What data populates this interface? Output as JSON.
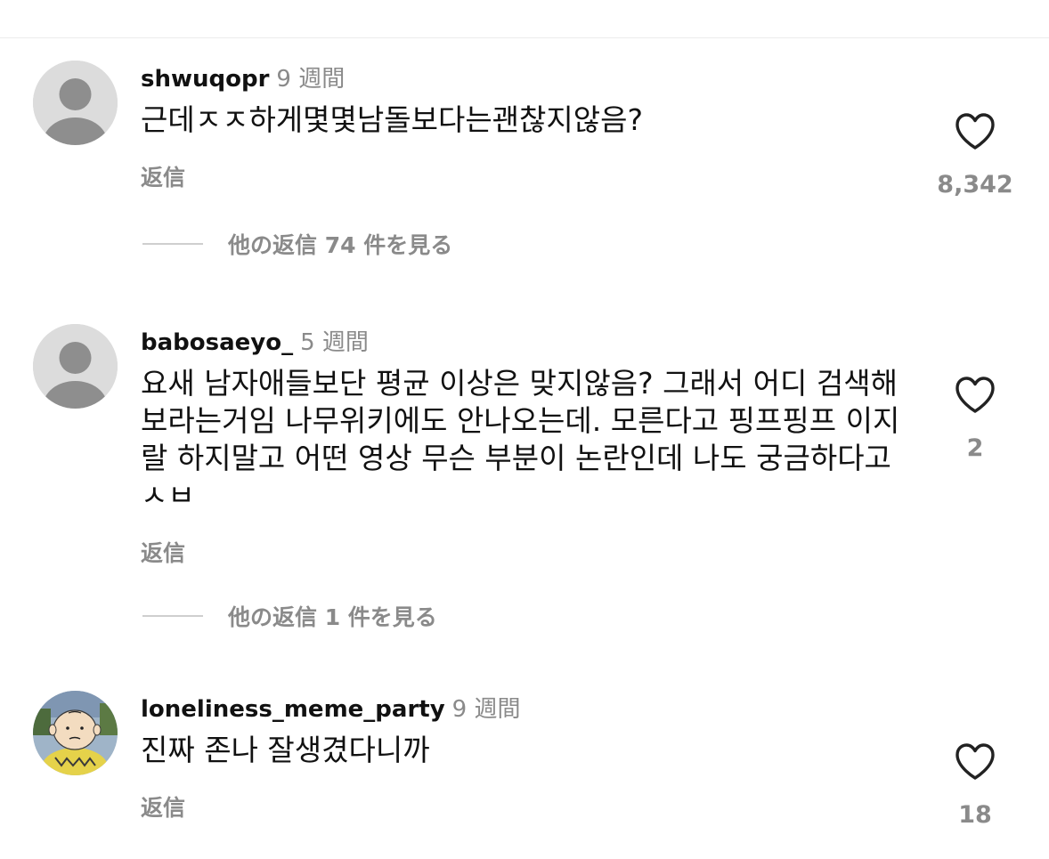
{
  "reply_label": "返信",
  "comments": [
    {
      "username": "shwuqopr",
      "time": "9 週間",
      "text": "근데ㅈㅈ하게몇몇남돌보다는괜찮지않음?",
      "likes": "8,342",
      "view_replies": "他の返信 74 件を見る",
      "avatar_icon": "default-avatar-icon"
    },
    {
      "username": "babosaeyo_",
      "time": "5 週間",
      "text": "요새 남자애들보단 평균 이상은 맞지않음? 그래서 어디 검색해보라는거임 나무위키에도 안나오는데. 모른다고 핑프핑프 이지랄 하지말고 어떤 영상 무슨 부분이 논란인데 나도 궁금하다고 ㅅㅂ",
      "likes": "2",
      "view_replies": "他の返信 1 件を見る",
      "avatar_icon": "default-avatar-icon"
    },
    {
      "username": "loneliness_meme_party",
      "time": "9 週間",
      "text": "진짜 존나 잘생겼다니까",
      "likes": "18",
      "avatar_icon": "cartoon-avatar-icon"
    }
  ],
  "colors": {
    "muted": "#8a8a8a",
    "divider": "#ececec",
    "avatar_bg": "#d9d9d9",
    "avatar_fg": "#8e8e8e"
  }
}
